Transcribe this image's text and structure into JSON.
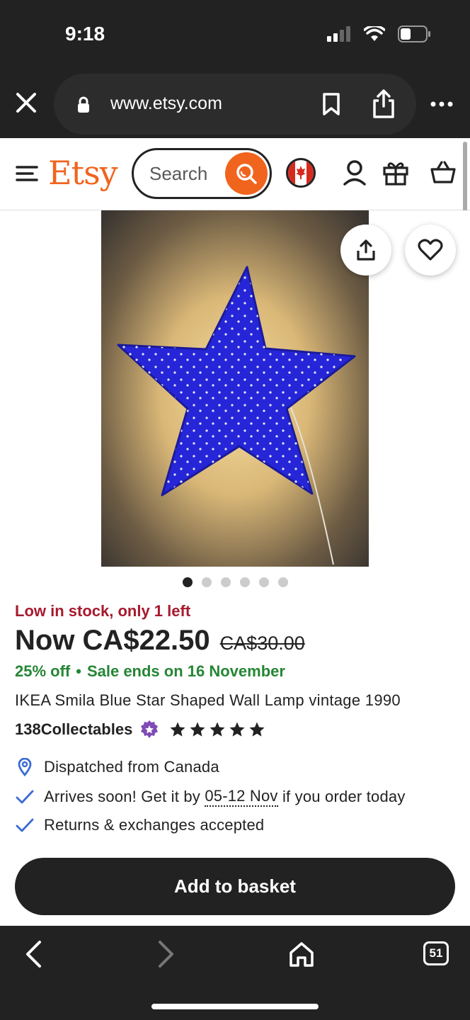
{
  "status_bar": {
    "time": "9:18"
  },
  "browser": {
    "url": "www.etsy.com",
    "tab_count": "51"
  },
  "header": {
    "logo": "Etsy",
    "search_placeholder": "Search"
  },
  "product": {
    "stock_note": "Low in stock, only 1 left",
    "price_now": "Now CA$22.50",
    "price_old": "CA$30.00",
    "discount": "25% off",
    "sale_end": "Sale ends on 16 November",
    "title": "IKEA Smila Blue Star Shaped Wall Lamp vintage 1990",
    "shop_name": "138Collectables",
    "rating_stars": 5,
    "image_count": 6,
    "active_image": 1
  },
  "features": {
    "dispatch": "Dispatched from Canada",
    "arrival_prefix": "Arrives soon! Get it by ",
    "arrival_dates": "05-12 Nov",
    "arrival_suffix": " if you order today",
    "returns": "Returns & exchanges accepted"
  },
  "actions": {
    "add_to_basket": "Add to basket"
  },
  "colors": {
    "brand": "#F1641E",
    "stock_red": "#A61A2E",
    "sale_green": "#258635",
    "star_blue": "#2a2ae0"
  }
}
